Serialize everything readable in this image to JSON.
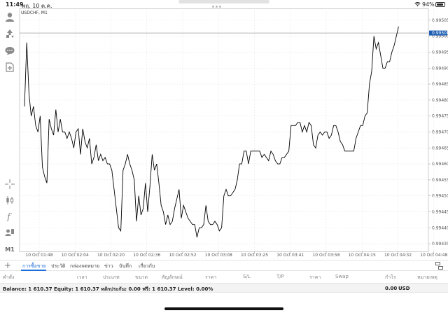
{
  "status": {
    "time": "11:49",
    "date": "พฤ. 10 ต.ค.",
    "battery": "94%",
    "battery_level": 0.94
  },
  "chart": {
    "symbol": "USDCHF, M1",
    "current_price": "0.99501",
    "price_labels": [
      "0.99505",
      "0.99500",
      "0.99495",
      "0.99490",
      "0.99485",
      "0.99480",
      "0.99475",
      "0.99470",
      "0.99465",
      "0.99460",
      "0.99455",
      "0.99450",
      "0.99445",
      "0.99440",
      "0.99435"
    ],
    "time_labels": [
      "10 Oct 01:48",
      "10 Oct 02:04",
      "10 Oct 02:20",
      "10 Oct 02:36",
      "10 Oct 02:52",
      "10 Oct 03:08",
      "10 Oct 03:25",
      "10 Oct 03:41",
      "10 Oct 03:58",
      "10 Oct 04:15",
      "10 Oct 04:32",
      "10 Oct 04:48"
    ],
    "line_color": "#000000",
    "price_line_color": "#999999",
    "badge_color": "#1e5fb3"
  },
  "chart_data": {
    "type": "line",
    "title": "USDCHF, M1",
    "xlabel": "",
    "ylabel": "",
    "ylim": [
      0.994326,
      0.995087
    ],
    "grid": true,
    "x": [
      "01:48",
      "01:49",
      "01:50",
      "01:51",
      "01:52",
      "01:53",
      "01:54",
      "01:55",
      "01:56",
      "01:57",
      "01:58",
      "01:59",
      "02:00",
      "02:01",
      "02:02",
      "02:03",
      "02:04",
      "02:05",
      "02:06",
      "02:07",
      "02:08",
      "02:09",
      "02:10",
      "02:11",
      "02:12",
      "02:13",
      "02:14",
      "02:15",
      "02:16",
      "02:17",
      "02:18",
      "02:19",
      "02:20",
      "02:21",
      "02:22",
      "02:23",
      "02:24",
      "02:25",
      "02:26",
      "02:27",
      "02:28",
      "02:29",
      "02:30",
      "02:31",
      "02:32",
      "02:33",
      "02:34",
      "02:35",
      "02:36",
      "02:37",
      "02:38",
      "02:39",
      "02:40",
      "02:41",
      "02:42",
      "02:43",
      "02:44",
      "02:45",
      "02:46",
      "02:47",
      "02:48",
      "02:49",
      "02:50",
      "02:51",
      "02:52",
      "02:53",
      "02:54",
      "02:55",
      "02:56",
      "02:57",
      "02:58",
      "02:59",
      "03:00",
      "03:01",
      "03:02",
      "03:03",
      "03:04",
      "03:05",
      "03:06",
      "03:07",
      "03:08",
      "03:09",
      "03:10",
      "03:11",
      "03:12",
      "03:13",
      "03:14",
      "03:15",
      "03:16",
      "03:17",
      "03:18",
      "03:19",
      "03:20",
      "03:21",
      "03:22",
      "03:23",
      "03:24",
      "03:25",
      "03:26",
      "03:27",
      "03:28",
      "03:29",
      "03:30",
      "03:31",
      "03:32",
      "03:33",
      "03:34",
      "03:35",
      "03:36",
      "03:37",
      "03:38",
      "03:39",
      "03:40",
      "03:41",
      "03:42",
      "03:43",
      "03:44",
      "03:45",
      "03:46",
      "03:47",
      "03:48",
      "03:49",
      "03:50",
      "03:51",
      "03:52",
      "03:53",
      "03:54",
      "03:55",
      "03:56",
      "03:57",
      "03:58",
      "03:59",
      "04:00",
      "04:01",
      "04:02",
      "04:03",
      "04:04",
      "04:05",
      "04:06",
      "04:07",
      "04:08",
      "04:09",
      "04:10",
      "04:11",
      "04:12",
      "04:13",
      "04:14",
      "04:15",
      "04:16",
      "04:17",
      "04:18",
      "04:19",
      "04:20",
      "04:21",
      "04:22",
      "04:23",
      "04:24",
      "04:25",
      "04:26",
      "04:27",
      "04:28",
      "04:29",
      "04:30",
      "04:31",
      "04:32",
      "04:33",
      "04:34",
      "04:35",
      "04:36",
      "04:37",
      "04:38",
      "04:39",
      "04:40",
      "04:41",
      "04:42",
      "04:43",
      "04:44",
      "04:45"
    ],
    "series": [
      {
        "values": [
          0.99478,
          0.99498,
          0.99482,
          0.99475,
          0.99478,
          0.99472,
          0.9947,
          0.99475,
          0.99459,
          0.99456,
          0.99454,
          0.99474,
          0.99471,
          0.99469,
          0.99477,
          0.9947,
          0.99474,
          0.9947,
          0.9947,
          0.99468,
          0.9947,
          0.99468,
          0.99465,
          0.9947,
          0.99471,
          0.99463,
          0.99471,
          0.99467,
          0.99465,
          0.99468,
          0.9946,
          0.99462,
          0.99466,
          0.99461,
          0.99463,
          0.99461,
          0.99462,
          0.9946,
          0.9946,
          0.99458,
          0.99452,
          0.99446,
          0.9944,
          0.99439,
          0.99458,
          0.9946,
          0.99463,
          0.9946,
          0.99458,
          0.99455,
          0.99442,
          0.9945,
          0.99444,
          0.99446,
          0.99454,
          0.99445,
          0.99453,
          0.99463,
          0.99458,
          0.9946,
          0.99454,
          0.99447,
          0.99445,
          0.99441,
          0.99444,
          0.99441,
          0.99442,
          0.99446,
          0.99449,
          0.99452,
          0.99443,
          0.99447,
          0.99445,
          0.99443,
          0.99442,
          0.99441,
          0.99441,
          0.99437,
          0.9944,
          0.9944,
          0.99441,
          0.99447,
          0.99442,
          0.99441,
          0.99441,
          0.99442,
          0.99441,
          0.99439,
          0.9944,
          0.9945,
          0.99452,
          0.9945,
          0.9945,
          0.99451,
          0.99452,
          0.99455,
          0.9946,
          0.9946,
          0.99464,
          0.99464,
          0.9946,
          0.99464,
          0.99464,
          0.99464,
          0.99464,
          0.99464,
          0.99462,
          0.99463,
          0.99462,
          0.99461,
          0.99464,
          0.99463,
          0.99461,
          0.9946,
          0.9946,
          0.99462,
          0.99462,
          0.99463,
          0.99464,
          0.99472,
          0.99472,
          0.99472,
          0.99473,
          0.99473,
          0.9947,
          0.99472,
          0.9947,
          0.99473,
          0.99472,
          0.99466,
          0.99465,
          0.99469,
          0.9947,
          0.99469,
          0.9947,
          0.9947,
          0.99468,
          0.99469,
          0.99472,
          0.99472,
          0.9947,
          0.99467,
          0.99466,
          0.99464,
          0.99464,
          0.99464,
          0.99464,
          0.99464,
          0.99468,
          0.9947,
          0.99472,
          0.99472,
          0.99475,
          0.99476,
          0.99485,
          0.99489,
          0.995,
          0.99496,
          0.99498,
          0.99494,
          0.9949,
          0.9949,
          0.99492,
          0.99492,
          0.99495,
          0.99497,
          0.995,
          0.99503
        ]
      }
    ]
  },
  "tabs": {
    "add_label": "+",
    "items": [
      "การซื้อขาย",
      "ประวัติ",
      "กล่องจดหมาย",
      "ข่าว",
      "บันทึก",
      "เกี่ยวกับ"
    ]
  },
  "columns": [
    "คำสั่ง",
    "เวลา",
    "ประเภท",
    "ขนาด",
    "สัญลักษณ์",
    "ราคา",
    "S/L",
    "T/P",
    "ราคา",
    "Swap",
    "กำไร",
    "หมายเหตุ"
  ],
  "balance": {
    "text": "Balance: 1 610.37 Equity: 1 610.37 หลักประกัน: 0.00 ฟรี: 1 610.37 Level: 0.00%",
    "total": "0.00",
    "currency": "USD"
  },
  "toolbar": {
    "period": "M1"
  }
}
